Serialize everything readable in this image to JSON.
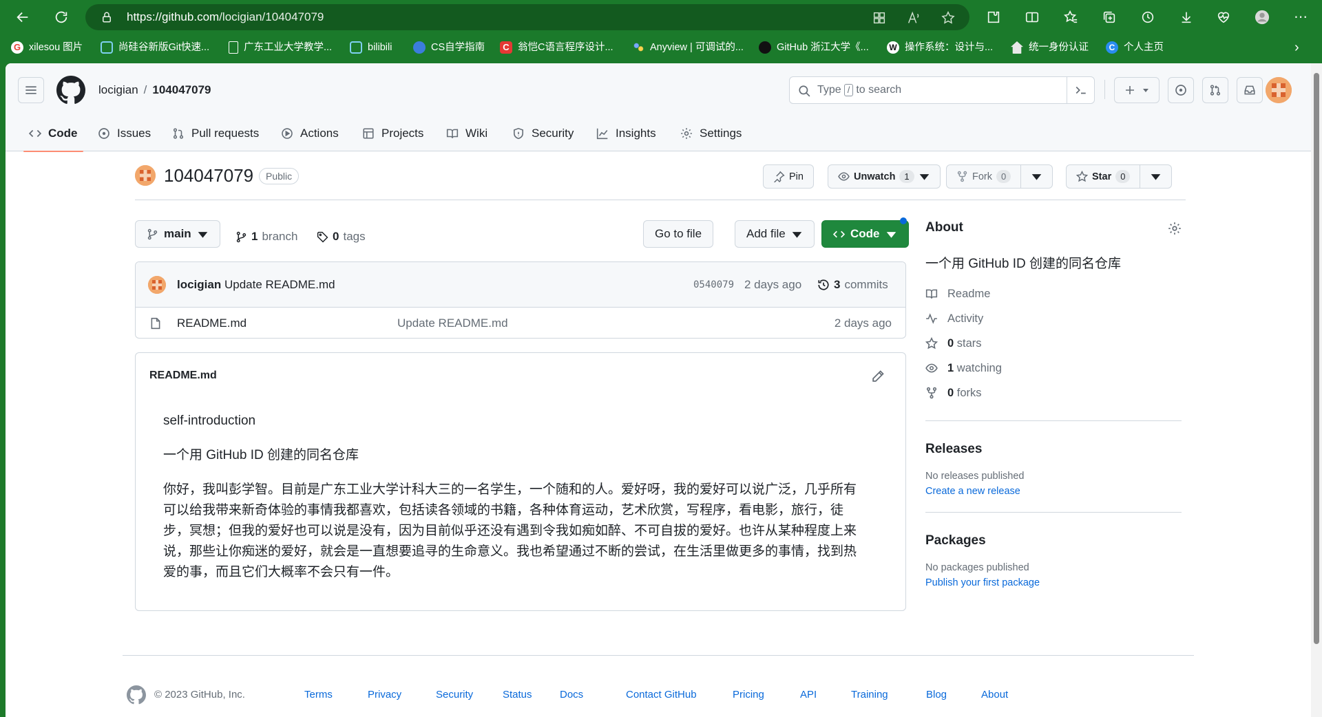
{
  "browser": {
    "url_host": "https://github.com",
    "url_path": "/locigian/104047079",
    "bookmarks": [
      {
        "label": "xilesou 图片",
        "icon": "google-icon",
        "color": "#ea4335"
      },
      {
        "label": "尚硅谷新版Git快速...",
        "icon": "bilibili-icon",
        "color": "#00a1d6"
      },
      {
        "label": "广东工业大学教学...",
        "icon": "page-icon",
        "color": "#ffffff"
      },
      {
        "label": "bilibili",
        "icon": "bilibili-icon",
        "color": "#00a1d6"
      },
      {
        "label": "CS自学指南",
        "icon": "cube-icon",
        "color": "#3b7ddd"
      },
      {
        "label": "翁恺C语言程序设计...",
        "icon": "c-icon",
        "color": "#e53935"
      },
      {
        "label": "Anyview | 可调试的...",
        "icon": "dots-icon",
        "color": "#7aa7ff"
      },
      {
        "label": "GitHub 浙江大学《...",
        "icon": "github-icon",
        "color": "#111111"
      },
      {
        "label": "操作系统：设计与...",
        "icon": "w-icon",
        "color": "#111111"
      },
      {
        "label": "统一身份认证",
        "icon": "house-icon",
        "color": "#e8e8e8"
      },
      {
        "label": "个人主页",
        "icon": "c-circle-icon",
        "color": "#2a8df0"
      }
    ]
  },
  "header": {
    "owner": "locigian",
    "separator": "/",
    "repo": "104047079",
    "search_before": "Type",
    "search_key": "/",
    "search_after": "to search"
  },
  "tabs": [
    {
      "label": "Code",
      "icon": "code-icon"
    },
    {
      "label": "Issues",
      "icon": "issue-icon"
    },
    {
      "label": "Pull requests",
      "icon": "pull-request-icon"
    },
    {
      "label": "Actions",
      "icon": "play-icon"
    },
    {
      "label": "Projects",
      "icon": "table-icon"
    },
    {
      "label": "Wiki",
      "icon": "book-icon"
    },
    {
      "label": "Security",
      "icon": "shield-icon"
    },
    {
      "label": "Insights",
      "icon": "graph-icon"
    },
    {
      "label": "Settings",
      "icon": "gear-icon"
    }
  ],
  "repo": {
    "name": "104047079",
    "visibility": "Public",
    "pin": "Pin",
    "unwatch": "Unwatch",
    "watch_count": "1",
    "fork": "Fork",
    "fork_count": "0",
    "star": "Star",
    "star_count": "0"
  },
  "toolbar": {
    "branch": "main",
    "branch_count": "1",
    "branch_word": "branch",
    "tag_count": "0",
    "tag_word": "tags",
    "go_to_file": "Go to file",
    "add_file": "Add file",
    "code": "Code"
  },
  "latest_commit": {
    "author": "locigian",
    "message": "Update README.md",
    "sha": "0540079",
    "when": "2 days ago",
    "commit_count": "3",
    "commit_word": "commits"
  },
  "files": [
    {
      "name": "README.md",
      "message": "Update README.md",
      "date": "2 days ago"
    }
  ],
  "readme": {
    "title": "README.md",
    "heading": "self-introduction",
    "line2": "一个用 GitHub ID 创建的同名仓库",
    "paragraph": "你好，我叫彭学智。目前是广东工业大学计科大三的一名学生，一个随和的人。爱好呀，我的爱好可以说广泛，几乎所有可以给我带来新奇体验的事情我都喜欢，包括读各领域的书籍，各种体育运动，艺术欣赏，写程序，看电影，旅行，徒步，冥想；但我的爱好也可以说是没有，因为目前似乎还没有遇到令我如痴如醉、不可自拔的爱好。也许从某种程度上来说，那些让你痴迷的爱好，就会是一直想要追寻的生命意义。我也希望通过不断的尝试，在生活里做更多的事情，找到热爱的事，而且它们大概率不会只有一件。"
  },
  "about": {
    "title": "About",
    "description": "一个用 GitHub ID 创建的同名仓库",
    "readme": "Readme",
    "activity": "Activity",
    "stars_count": "0",
    "stars_word": "stars",
    "watching_count": "1",
    "watching_word": "watching",
    "forks_count": "0",
    "forks_word": "forks"
  },
  "releases": {
    "title": "Releases",
    "empty": "No releases published",
    "link": "Create a new release"
  },
  "packages": {
    "title": "Packages",
    "empty": "No packages published",
    "link": "Publish your first package"
  },
  "footer": {
    "copyright": "© 2023 GitHub, Inc.",
    "links": [
      "Terms",
      "Privacy",
      "Security",
      "Status",
      "Docs",
      "Contact GitHub",
      "Pricing",
      "API",
      "Training",
      "Blog",
      "About"
    ]
  },
  "colors": {
    "browser_chrome": "#1b7a2b",
    "accent_tab": "#fd8c73",
    "green_button": "#1f883d",
    "link_blue": "#0969da",
    "avatar_orange": "#f2a76b"
  }
}
